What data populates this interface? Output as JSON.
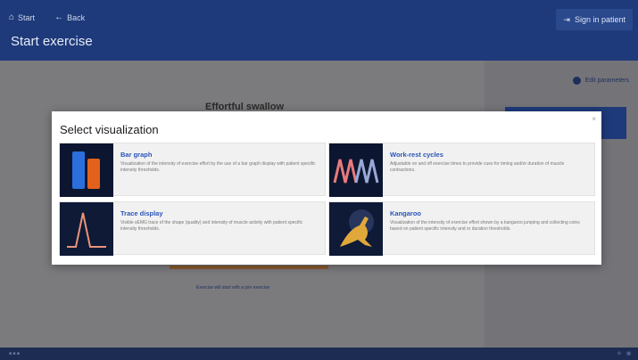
{
  "header": {
    "nav": {
      "start_label": "Start",
      "back_label": "Back"
    },
    "title": "Start exercise",
    "signin_label": "Sign in patient"
  },
  "background": {
    "edit_parameters": "Edit parameters",
    "exercise_title": "Effortful swallow",
    "start_note": "Exercise will start with a join exercise"
  },
  "modal": {
    "title": "Select visualization",
    "close_icon": "×",
    "options": [
      {
        "name": "Bar graph",
        "description": "Visualization of the intensity of exercise effort by the use of a bar graph display with patient specific intensity thresholds.",
        "icon": "bar-graph-icon"
      },
      {
        "name": "Work-rest cycles",
        "description": "Adjustable on and off exercise times to provide cues for timing and/or duration of muscle contractions.",
        "icon": "work-rest-icon"
      },
      {
        "name": "Trace display",
        "description": "Visible sEMG trace of the shape (quality) and intensity of muscle activity with patient specific intensity thresholds.",
        "icon": "trace-icon"
      },
      {
        "name": "Kangaroo",
        "description": "Visualization of the intensity of exercise effort shown by a kangaroo jumping and collecting coins based on patient specific intensity and or duration thresholds.",
        "icon": "kangaroo-icon"
      }
    ]
  },
  "colors": {
    "header_bg": "#1f3a7a",
    "accent_text": "#2a55b8",
    "bar_blue": "#2a6fdc",
    "bar_orange": "#e2611c"
  }
}
